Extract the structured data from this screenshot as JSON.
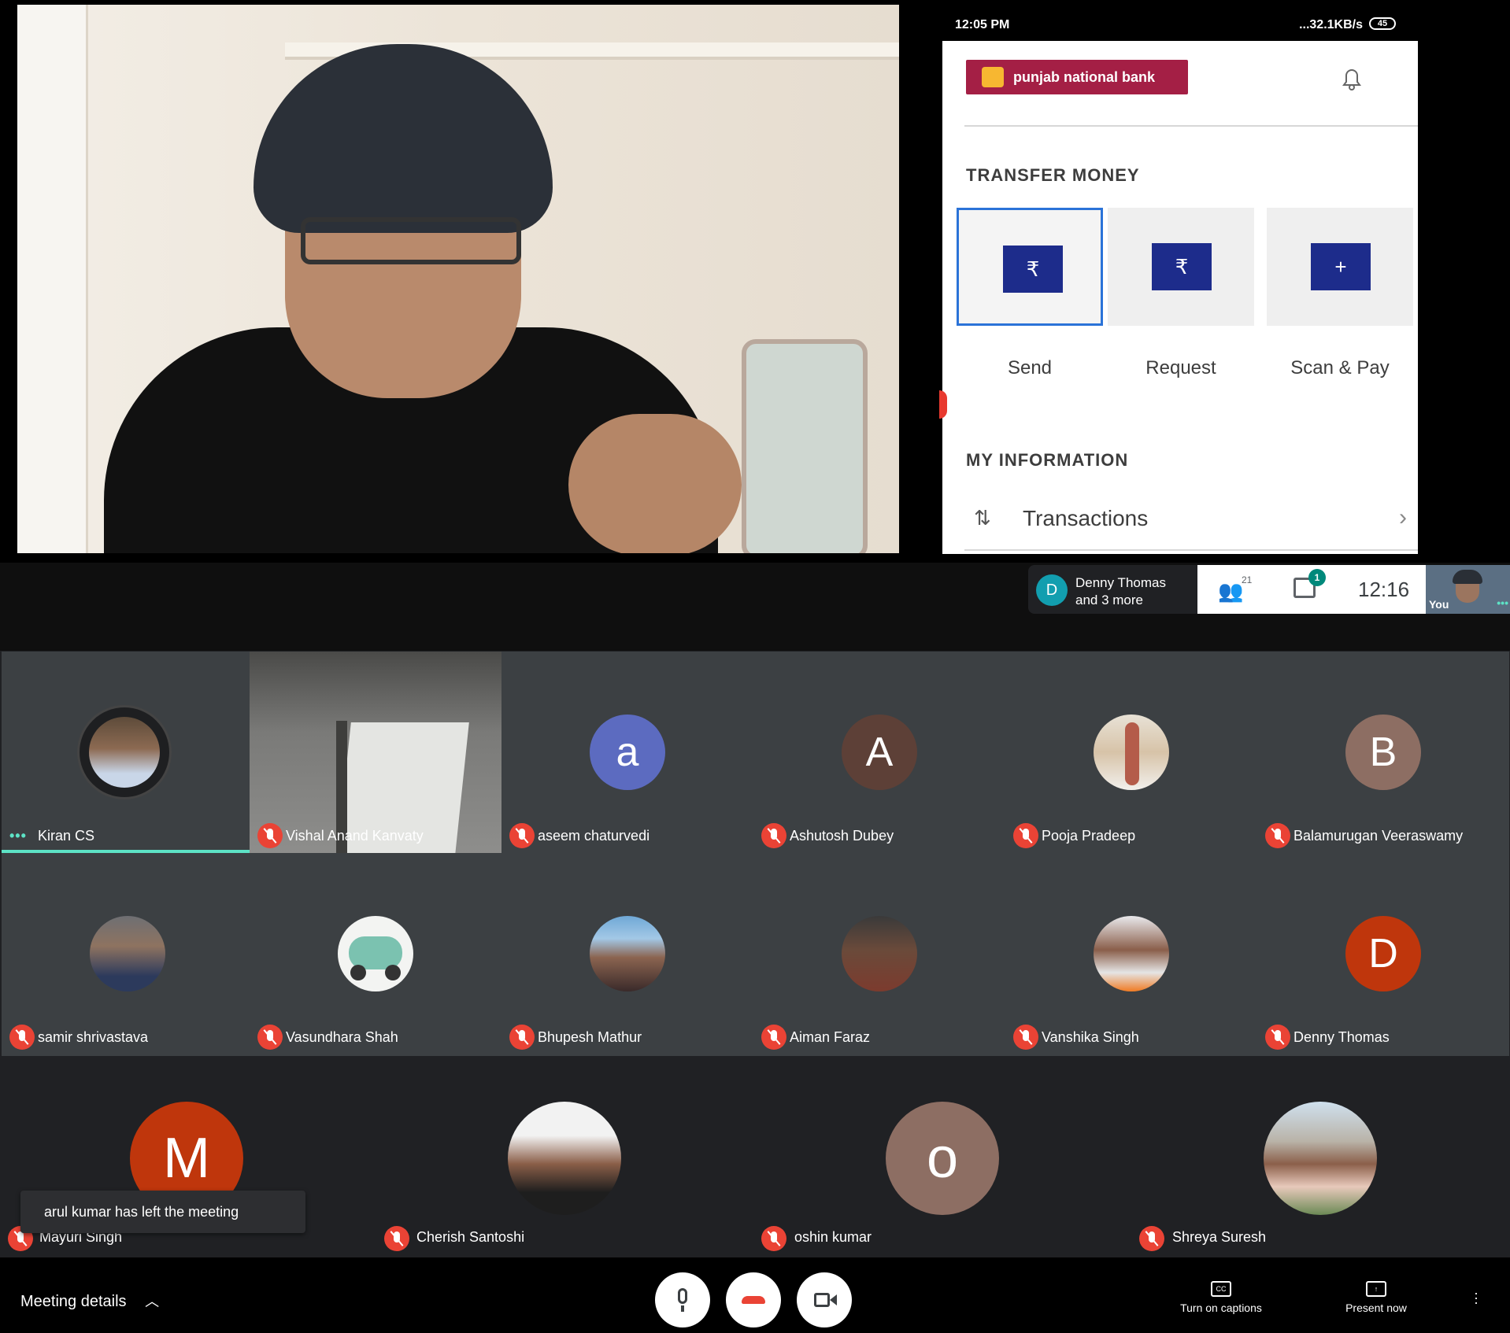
{
  "presentation": {
    "phone_status": {
      "time": "12:05 PM",
      "network": "...32.1KB/s",
      "battery": "45"
    },
    "app": {
      "logo_text": "punjab national bank",
      "section_transfer": "TRANSFER MONEY",
      "actions": [
        {
          "label": "Send",
          "glyph": "₹"
        },
        {
          "label": "Request",
          "glyph": "₹"
        },
        {
          "label": "Scan & Pay",
          "glyph": "+"
        }
      ],
      "section_info": "MY INFORMATION",
      "transactions_label": "Transactions"
    }
  },
  "header": {
    "speaking": {
      "initial": "D",
      "line1": "Denny Thomas",
      "line2": "and 3 more"
    },
    "participants_count": "21",
    "chat_badge": "1",
    "clock": "12:16",
    "self_label": "You"
  },
  "participants": {
    "row1": [
      {
        "name": "Kiran CS",
        "type": "photo",
        "speaking": true
      },
      {
        "name": "Vishal Anand Kanvaty",
        "type": "video"
      },
      {
        "name": "aseem chaturvedi",
        "type": "initial",
        "initial": "a",
        "color": "#5c6bc0"
      },
      {
        "name": "Ashutosh Dubey",
        "type": "initial",
        "initial": "A",
        "color": "#5d4037"
      },
      {
        "name": "Pooja Pradeep",
        "type": "photo"
      },
      {
        "name": "Balamurugan Veeraswamy",
        "type": "initial",
        "initial": "B",
        "color": "#8d6e63"
      }
    ],
    "row2": [
      {
        "name": "samir shrivastava",
        "type": "photo"
      },
      {
        "name": "Vasundhara Shah",
        "type": "photo"
      },
      {
        "name": "Bhupesh Mathur",
        "type": "photo"
      },
      {
        "name": "Aiman Faraz",
        "type": "photo"
      },
      {
        "name": "Vanshika Singh",
        "type": "photo"
      },
      {
        "name": "Denny Thomas",
        "type": "initial",
        "initial": "D",
        "color": "#bf360c"
      }
    ],
    "row3": [
      {
        "name": "Mayuri Singh",
        "type": "initial",
        "initial": "M",
        "color": "#bf360c"
      },
      {
        "name": "Cherish Santoshi",
        "type": "photo"
      },
      {
        "name": "oshin kumar",
        "type": "initial",
        "initial": "o",
        "color": "#8d6e63"
      },
      {
        "name": "Shreya Suresh",
        "type": "photo"
      }
    ]
  },
  "toast": "arul kumar has left the meeting",
  "controls": {
    "meeting_details": "Meeting details",
    "captions_label": "Turn on captions",
    "captions_icon": "CC",
    "present_label": "Present now"
  }
}
